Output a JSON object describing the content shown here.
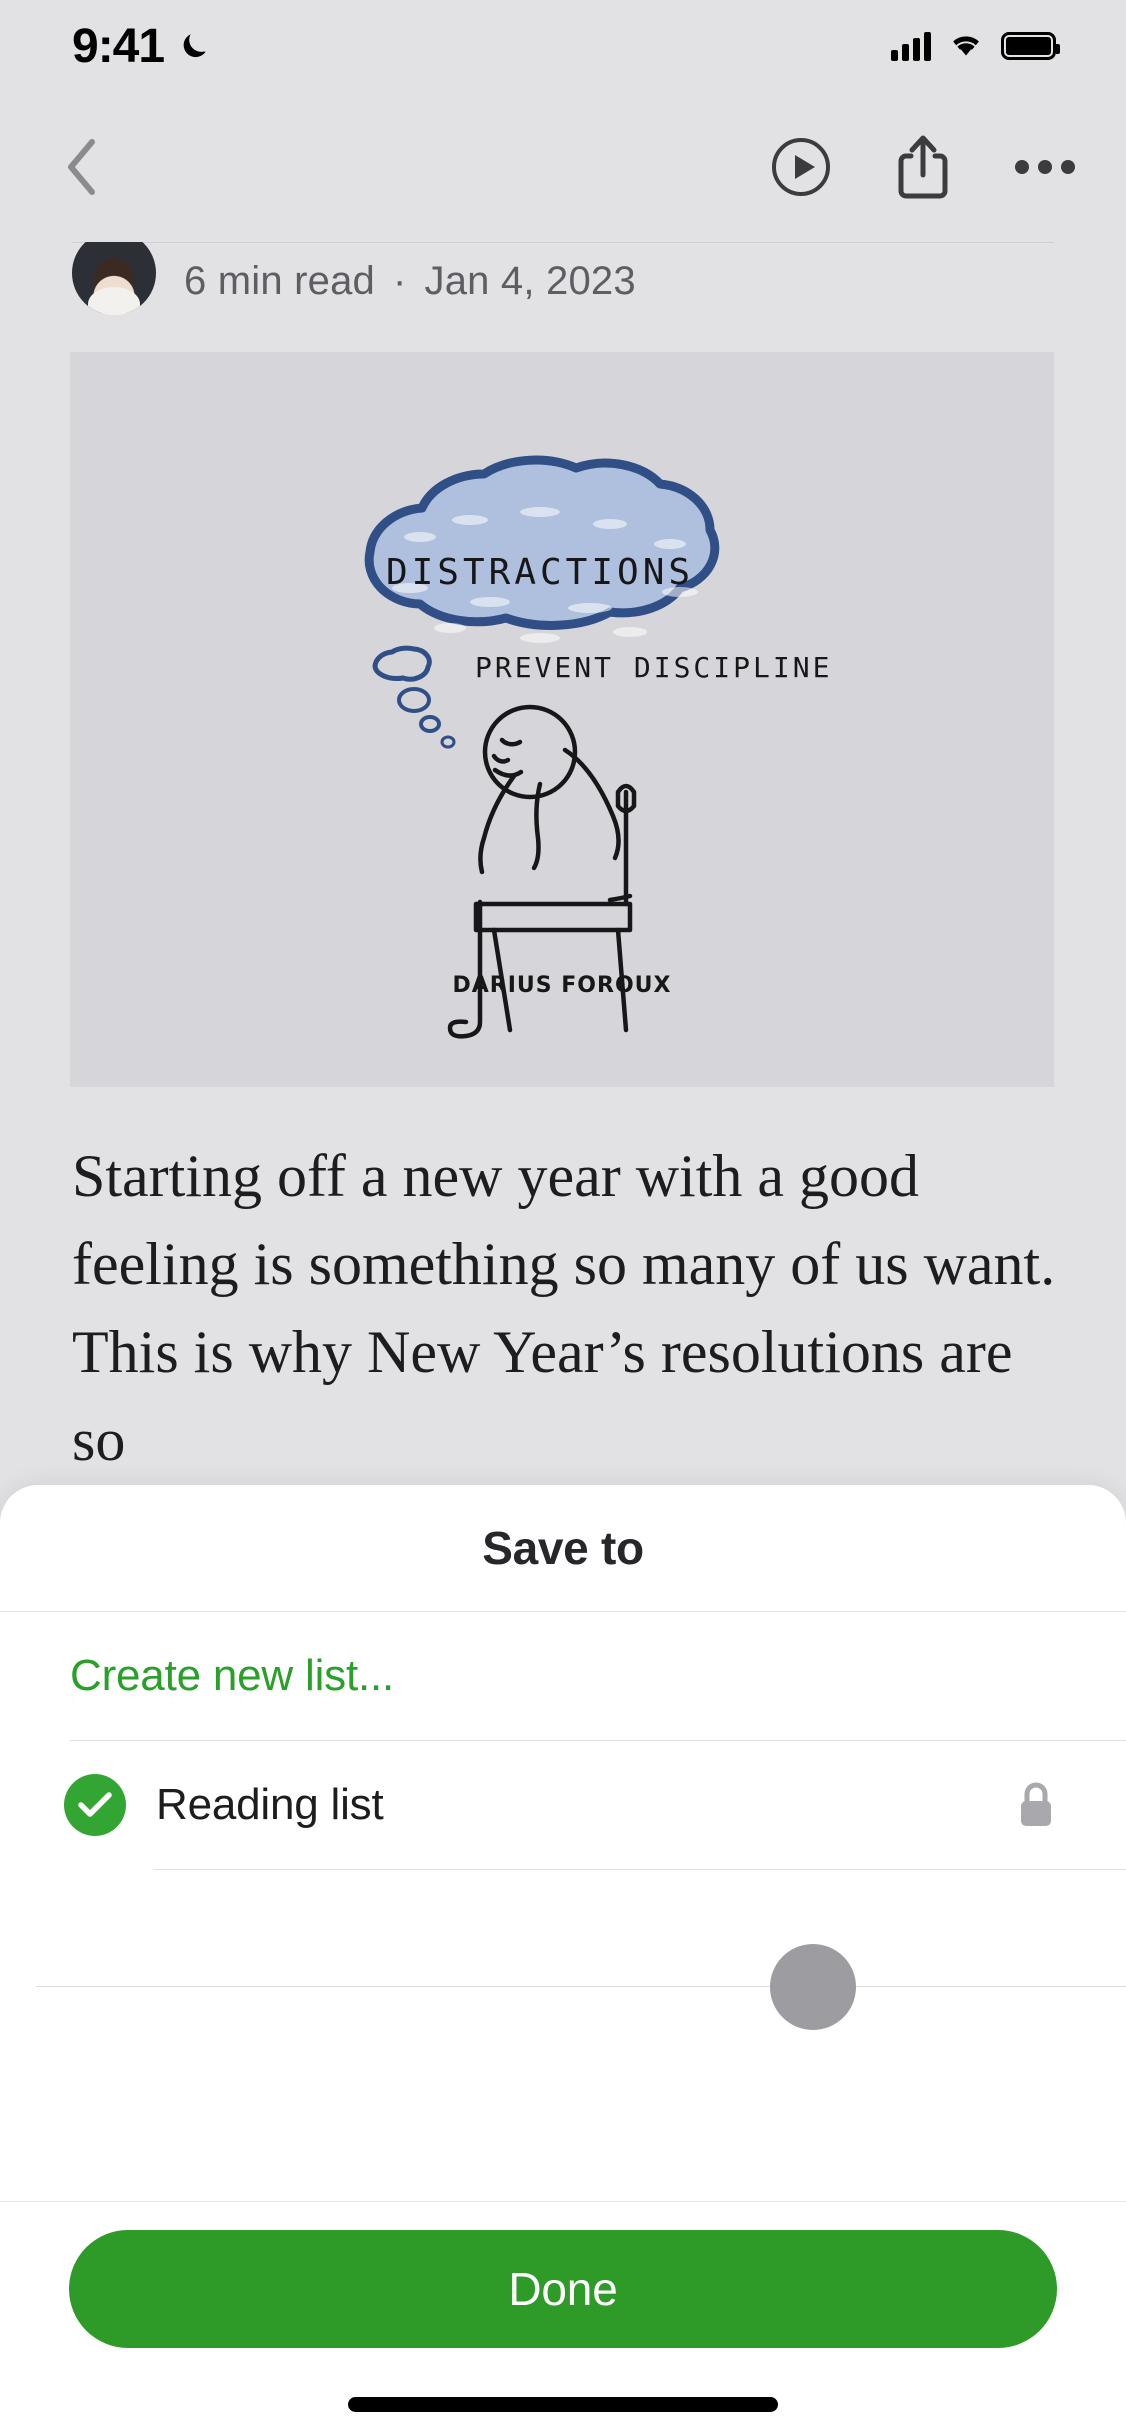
{
  "status_bar": {
    "time": "9:41",
    "moon_icon": "crescent-moon-icon",
    "cellular_icon": "cellular-bars-icon",
    "wifi_icon": "wifi-icon",
    "battery_icon": "battery-full-icon"
  },
  "nav_bar": {
    "back_icon": "chevron-left-icon",
    "listen_icon": "play-circle-icon",
    "share_icon": "share-up-icon",
    "more_icon": "ellipsis-icon"
  },
  "article": {
    "avatar": "author-avatar",
    "read_time": "6 min read",
    "separator": "·",
    "date": "Jan 4, 2023",
    "hero": {
      "cloud_text": "DISTRACTIONS",
      "subtitle_text": "PREVENT DISCIPLINE",
      "signature": "DARIUS FOROUX",
      "cloud_color": "#2f4f86",
      "cloud_fill": "#aec0dd",
      "background": "#d6d5d9"
    },
    "body": "Starting off a new year with a good feeling is something so many of us want. This is why New Year’s resolutions are so"
  },
  "sheet": {
    "title": "Save to",
    "create_new_list": "Create new list...",
    "accent_color": "#2aa02a",
    "items": [
      {
        "label": "Reading list",
        "selected": true,
        "check_icon": "check-circle-icon",
        "privacy_icon": "lock-icon"
      }
    ],
    "placeholder_avatar": "placeholder-avatar",
    "done_label": "Done",
    "done_color": "#2e9b29"
  },
  "home_indicator": "home-indicator"
}
